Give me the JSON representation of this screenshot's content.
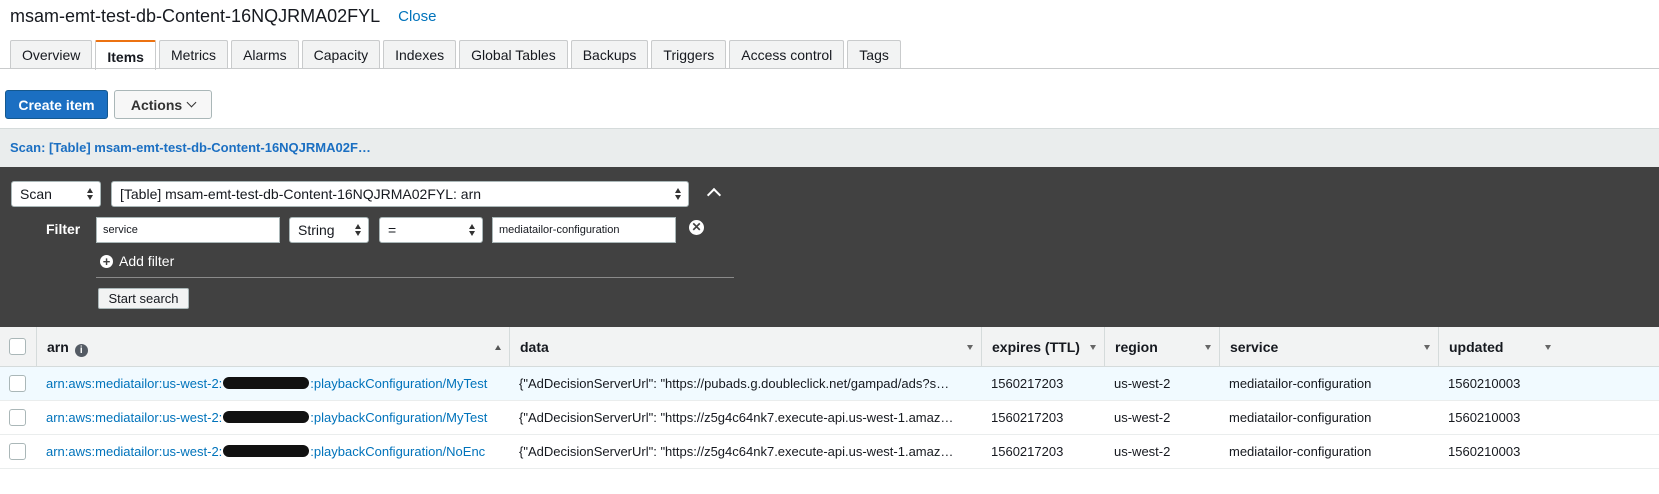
{
  "header": {
    "title": "msam-emt-test-db-Content-16NQJRMA02FYL",
    "close_label": "Close"
  },
  "tabs": [
    {
      "label": "Overview",
      "active": false
    },
    {
      "label": "Items",
      "active": true
    },
    {
      "label": "Metrics",
      "active": false
    },
    {
      "label": "Alarms",
      "active": false
    },
    {
      "label": "Capacity",
      "active": false
    },
    {
      "label": "Indexes",
      "active": false
    },
    {
      "label": "Global Tables",
      "active": false
    },
    {
      "label": "Backups",
      "active": false
    },
    {
      "label": "Triggers",
      "active": false
    },
    {
      "label": "Access control",
      "active": false
    },
    {
      "label": "Tags",
      "active": false
    }
  ],
  "toolbar": {
    "create_label": "Create item",
    "actions_label": "Actions"
  },
  "scan": {
    "header_label": "Scan: [Table] msam-emt-test-db-Content-16NQJRMA02F…",
    "mode": "Scan",
    "target": "[Table] msam-emt-test-db-Content-16NQJRMA02FYL: arn",
    "filter_label": "Filter",
    "filter": {
      "attribute": "service",
      "type": "String",
      "operator": "=",
      "value": "mediatailor-configuration"
    },
    "add_filter_label": "Add filter",
    "start_label": "Start search"
  },
  "table": {
    "columns": [
      "arn",
      "data",
      "expires (TTL)",
      "region",
      "service",
      "updated"
    ],
    "rows": [
      {
        "arn_prefix": "arn:aws:mediatailor:us-west-2:",
        "arn_suffix": ":playbackConfiguration/MyTest",
        "data": "{\"AdDecisionServerUrl\": \"https://pubads.g.doubleclick.net/gampad/ads?s…",
        "expires": "1560217203",
        "region": "us-west-2",
        "service": "mediatailor-configuration",
        "updated": "1560210003"
      },
      {
        "arn_prefix": "arn:aws:mediatailor:us-west-2:",
        "arn_suffix": ":playbackConfiguration/MyTest",
        "data": "{\"AdDecisionServerUrl\": \"https://z5g4c64nk7.execute-api.us-west-1.amaz…",
        "expires": "1560217203",
        "region": "us-west-2",
        "service": "mediatailor-configuration",
        "updated": "1560210003"
      },
      {
        "arn_prefix": "arn:aws:mediatailor:us-west-2:",
        "arn_suffix": ":playbackConfiguration/NoEnc",
        "data": "{\"AdDecisionServerUrl\": \"https://z5g4c64nk7.execute-api.us-west-1.amaz…",
        "expires": "1560217203",
        "region": "us-west-2",
        "service": "mediatailor-configuration",
        "updated": "1560210003"
      }
    ]
  }
}
